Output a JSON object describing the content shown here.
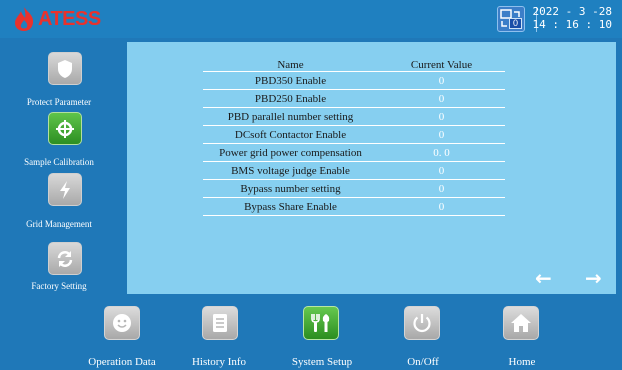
{
  "header": {
    "logo_text": "ATESS",
    "alarm_count": "0",
    "date": "2022 - 3 -28",
    "time": "14 : 16 : 10"
  },
  "sidebar": {
    "items": [
      {
        "label": "Protect Parameter",
        "icon": "shield-icon",
        "active": false
      },
      {
        "label": "Sample Calibration",
        "icon": "target-icon",
        "active": true
      },
      {
        "label": "Grid Management",
        "icon": "lightning-icon",
        "active": false
      },
      {
        "label": "Factory Setting",
        "icon": "refresh-icon",
        "active": false
      }
    ]
  },
  "table": {
    "col_name": "Name",
    "col_value": "Current Value",
    "rows": [
      {
        "name": "PBD350 Enable",
        "value": "0"
      },
      {
        "name": "PBD250 Enable",
        "value": "0"
      },
      {
        "name": "PBD parallel number setting",
        "value": "0"
      },
      {
        "name": "DCsoft Contactor Enable",
        "value": "0"
      },
      {
        "name": "Power grid power compensation",
        "value": "0. 0"
      },
      {
        "name": "BMS voltage judge Enable",
        "value": "0"
      },
      {
        "name": "Bypass number setting",
        "value": "0"
      },
      {
        "name": "Bypass Share Enable",
        "value": "0"
      }
    ]
  },
  "nav_arrows": {
    "prev": "←",
    "next": "→"
  },
  "bottom_nav": {
    "items": [
      {
        "label": "Operation Data",
        "icon": "smiley-icon",
        "active": false
      },
      {
        "label": "History Info",
        "icon": "document-icon",
        "active": false
      },
      {
        "label": "System Setup",
        "icon": "tools-icon",
        "active": true
      },
      {
        "label": "On/Off",
        "icon": "power-icon",
        "active": false
      },
      {
        "label": "Home",
        "icon": "home-icon",
        "active": false
      }
    ]
  },
  "colors": {
    "background": "#1f78b8",
    "panel": "#86cff0",
    "active_button": "#3fa82e",
    "logo_red": "#e9322d"
  }
}
